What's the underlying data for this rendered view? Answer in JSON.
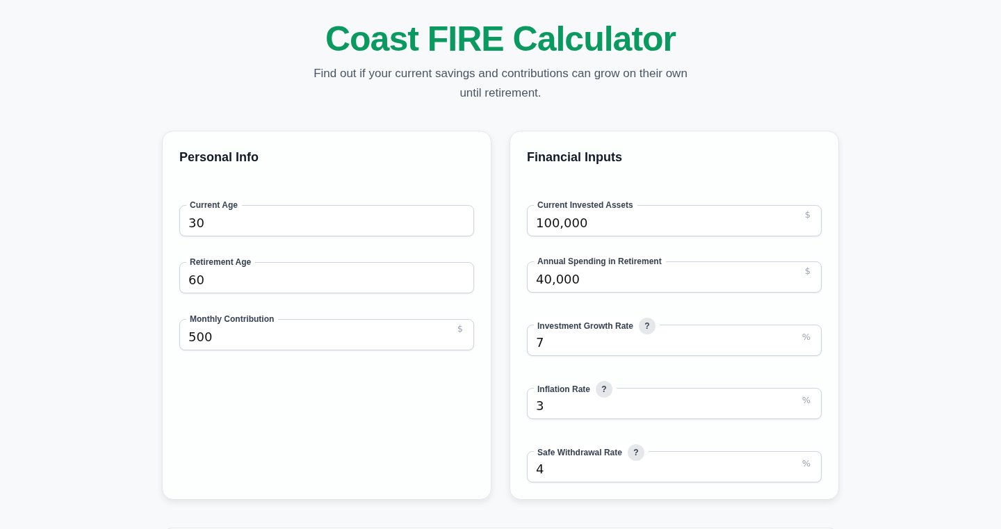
{
  "title": "Coast FIRE Calculator",
  "subtitle": "Find out if your current savings and contributions can grow on their own until retirement.",
  "cards": [
    {
      "heading": "Personal Info",
      "fields": [
        {
          "label": "Current Age",
          "value": "30"
        },
        {
          "label": "Retirement Age",
          "value": "60"
        },
        {
          "label": "Monthly Contribution",
          "value": "500",
          "unit": "$"
        }
      ]
    },
    {
      "heading": "Financial Inputs",
      "fields": [
        {
          "label": "Current Invested Assets",
          "value": "100,000",
          "unit": "$"
        },
        {
          "label": "Annual Spending in Retirement",
          "value": "40,000",
          "unit": "$"
        },
        {
          "label": "Investment Growth Rate",
          "value": "7",
          "unit": "%",
          "help_text": "?"
        },
        {
          "label": "Inflation Rate",
          "value": "3",
          "unit": "%",
          "help_text": "?"
        },
        {
          "label": "Safe Withdrawal Rate",
          "value": "4",
          "unit": "%",
          "help_text": "?"
        }
      ]
    }
  ]
}
